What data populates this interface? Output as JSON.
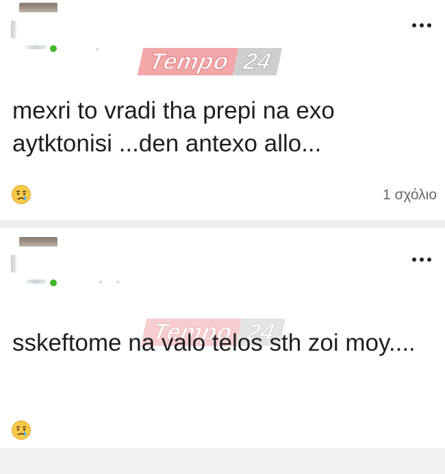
{
  "watermark": {
    "brand": "Tempo",
    "number": "24"
  },
  "posts": [
    {
      "text": "mexri to vradi tha prepi na exo aytktonisi ...den antexo allo...",
      "reaction_icon": "crying-face-icon",
      "comment_count": "1 σχόλιο"
    },
    {
      "text": "sskeftome na valo telos sth zoi moy....",
      "reaction_icon": "crying-face-icon",
      "comment_count": ""
    }
  ],
  "colors": {
    "online": "#42b72a",
    "text": "#1c1e21",
    "secondary_text": "#65676b",
    "watermark_red": "#f2a7a9",
    "watermark_gray": "#cfcfcf"
  }
}
